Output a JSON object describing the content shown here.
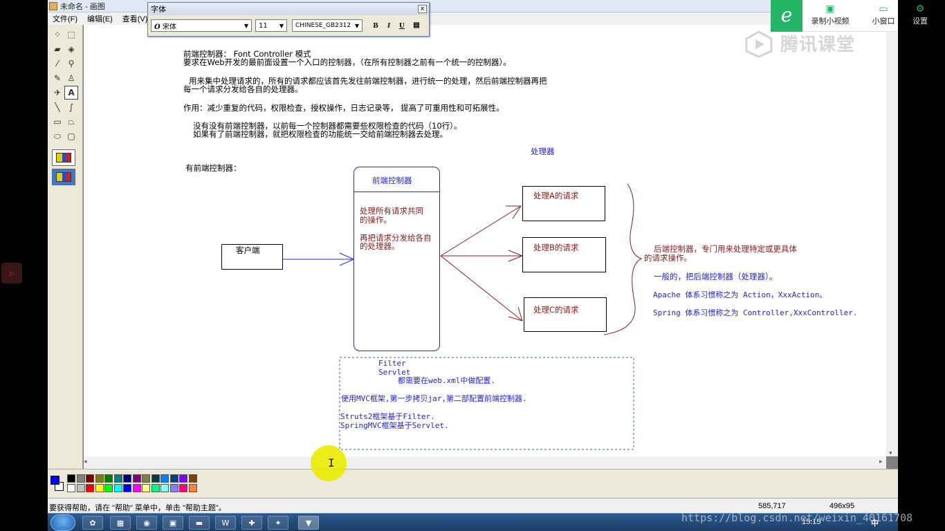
{
  "window": {
    "title": "未命名 - 画图",
    "menus": [
      "文件(F)",
      "编辑(E)",
      "查看(V)"
    ]
  },
  "font_dialog": {
    "title": "字体",
    "close": "x",
    "font_name": "宋体",
    "font_size": "11",
    "charset": "CHINESE_GB2312",
    "bold": "B",
    "italic": "I",
    "underline": "U"
  },
  "canvas": {
    "title_line": "前端控制器： Font Controller 模式",
    "line1": "要求在Web开发的最前面设置一个入口的控制器，（在所有控制器之前有一个统一的控制器）。",
    "line2a": "用来集中处理请求的，所有的请求都应该首先发往前端控制器，进行统一的处理，然后前端控制器再把",
    "line2b": "每一个请求分发给各自的处理器。",
    "line3": "作用：减少重复的代码，权限检查，授权操作，日志记录等，    提高了可重用性和可拓展性。",
    "line4a": "没有没有前端控制器，以前每一个控制器都需要些权限检查的代码（10行）。",
    "line4b": "如果有了前端控制器，就把权限检查的功能统一交给前端控制器去处理。",
    "processor_label": "处理器",
    "has_fc_label": "有前端控制器：",
    "client_label": "客户端",
    "fc_box_title": "前端控制器",
    "fc_desc1a": "处理所有请求共同",
    "fc_desc1b": "的操作。",
    "fc_desc2a": "再把请求分发给各自",
    "fc_desc2b": "的处理器。",
    "proc_a": "处理A的请求",
    "proc_b": "处理B的请求",
    "proc_c": "处理C的请求",
    "backend_a": "后端控制器，专门用来处理特定或更具体",
    "backend_b": "的请求操作。",
    "generally": "一般的，把后端控制器（处理器）。",
    "apache": "Apache 体系习惯称之为 Action，XxxAction。",
    "spring": "Spring 体系习惯称之为 Controller,XxxController.",
    "note_filter": "Filter",
    "note_servlet": "Servlet",
    "note_webxml": "都需要在web.xml中做配置.",
    "note_mvc": "使用MVC框架,第一步拷贝jar,第二部配置前端控制器.",
    "note_struts": "Struts2框架基于Filter.",
    "note_springmvc": "SpringMVC框架基于Servlet."
  },
  "status": {
    "help": "要获得帮助，请在 \"帮助\" 菜单中，单击 \"帮助主题\"。",
    "coords": "585,717",
    "size": "496x95"
  },
  "overlay": {
    "record_label": "录制小视频",
    "mini_label": "小窗口",
    "settings_label": "设置",
    "watermark": "腾讯课堂",
    "csdn": "https://blog.csdn.net/weixin_40161708"
  },
  "taskbar": {
    "clock": "15:15",
    "ime": "中"
  },
  "colors": {
    "red_text": "#8b1a1a",
    "blue_text": "#2323d8",
    "brand_green": "#25b566"
  },
  "palette_colors": [
    "#000000",
    "#808080",
    "#800000",
    "#808000",
    "#008000",
    "#008080",
    "#000080",
    "#800080",
    "#808040",
    "#004040",
    "#0080ff",
    "#004080",
    "#8000ff",
    "#804000",
    "#ffffff",
    "#c0c0c0",
    "#ff0000",
    "#ffff00",
    "#00ff00",
    "#00ffff",
    "#0000ff",
    "#ff00ff",
    "#ffff80",
    "#00ff80",
    "#80ffff",
    "#8080ff",
    "#ff0080",
    "#ff8040"
  ]
}
